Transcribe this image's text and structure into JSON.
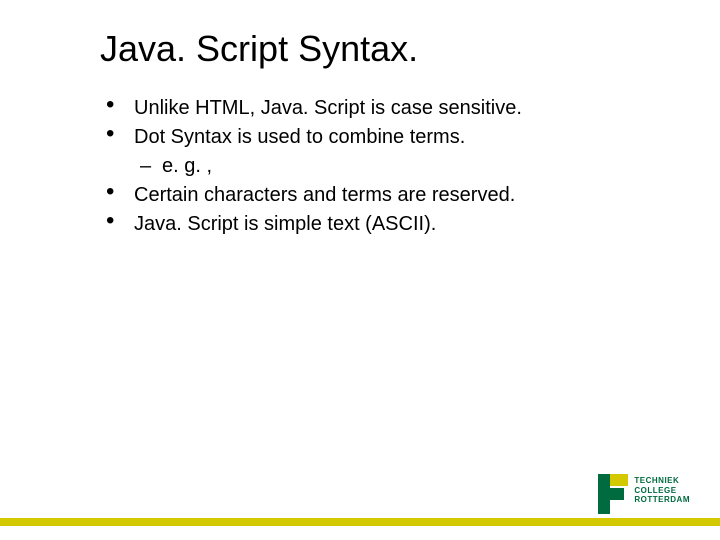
{
  "title": "Java. Script Syntax.",
  "bullets_group1": [
    "Unlike HTML, Java. Script is case sensitive.",
    "Dot Syntax is used to combine terms."
  ],
  "sub_bullet": "e. g. ,",
  "bullets_group2": [
    "Certain characters and terms are reserved.",
    " Java. Script is simple text (ASCII)."
  ],
  "logo": {
    "line1": "TECHNIEK",
    "line2": "COLLEGE",
    "line3": "ROTTERDAM",
    "sub": ""
  }
}
